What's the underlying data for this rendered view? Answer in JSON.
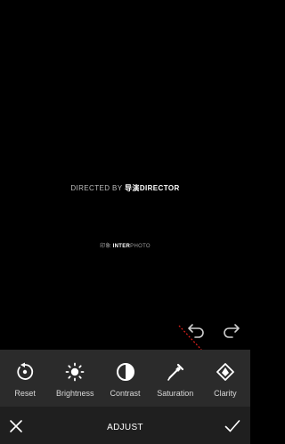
{
  "image": {
    "directed_prefix": "DIRECTED BY",
    "directed_brand_cn": "导演",
    "directed_brand": "DIRECTOR",
    "inter_prefix_cn": "印象",
    "inter_bold": "INTER",
    "inter_light": "PHOTO"
  },
  "tools": [
    {
      "label": "Reset",
      "icon": "reset-icon"
    },
    {
      "label": "Brightness",
      "icon": "brightness-icon"
    },
    {
      "label": "Contrast",
      "icon": "contrast-icon"
    },
    {
      "label": "Saturation",
      "icon": "saturation-icon"
    },
    {
      "label": "Clarity",
      "icon": "clarity-icon"
    }
  ],
  "bottom": {
    "title": "ADJUST"
  },
  "colors": {
    "toolbar": "#2b2b2b",
    "bottombar": "#1f1f1f",
    "annotation_arrow": "#e0201c"
  }
}
